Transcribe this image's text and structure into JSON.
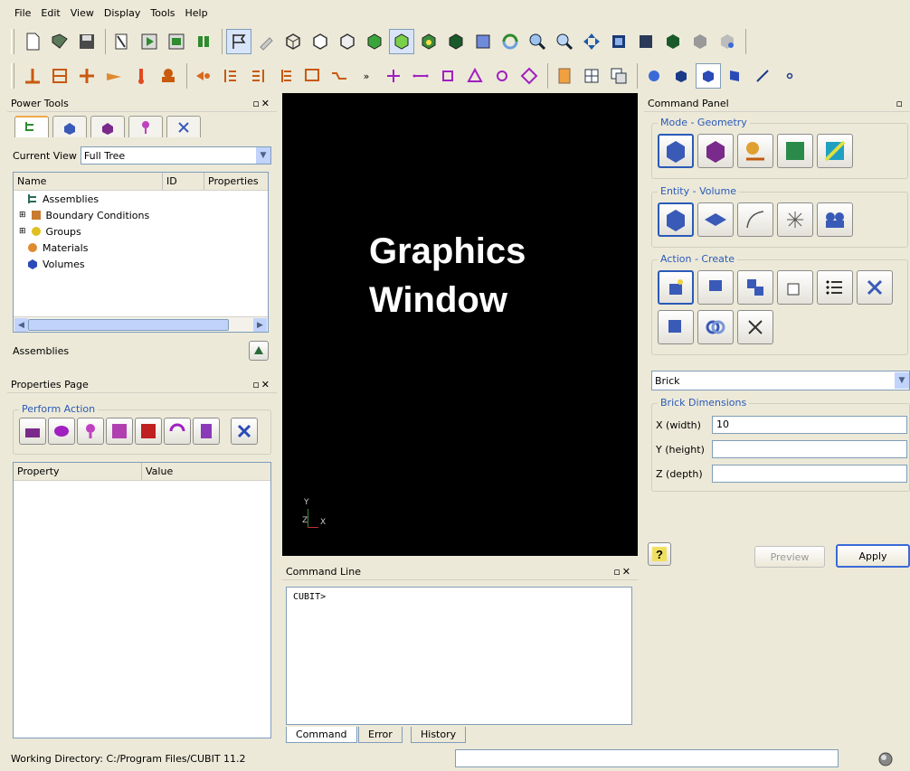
{
  "menu": [
    "File",
    "Edit",
    "View",
    "Display",
    "Tools",
    "Help"
  ],
  "power_tools": {
    "title": "Power Tools",
    "current_view_label": "Current View",
    "current_view_value": "Full Tree",
    "columns": [
      "Name",
      "ID",
      "Properties"
    ],
    "tree_items": [
      "Assemblies",
      "Boundary Conditions",
      "Groups",
      "Materials",
      "Volumes"
    ],
    "footer_label": "Assemblies"
  },
  "properties_page": {
    "title": "Properties Page",
    "perform_action": "Perform Action",
    "columns": [
      "Property",
      "Value"
    ]
  },
  "graphics": {
    "line1": "Graphics",
    "line2": "Window",
    "axis_y": "Y",
    "axis_z": "Z",
    "axis_x": "X"
  },
  "command_line": {
    "title": "Command Line",
    "prompt": "CUBIT>",
    "tabs": [
      "Command",
      "Error",
      "History"
    ]
  },
  "command_panel": {
    "title": "Command Panel",
    "mode_label": "Mode - Geometry",
    "entity_label": "Entity - Volume",
    "action_label": "Action - Create",
    "shape_value": "Brick",
    "dims_label": "Brick Dimensions",
    "x_label": "X (width)",
    "x_value": "10",
    "y_label": "Y (height)",
    "y_value": "",
    "z_label": "Z (depth)",
    "z_value": "",
    "preview": "Preview",
    "apply": "Apply"
  },
  "status": {
    "working_dir": "Working Directory: C:/Program Files/CUBIT 11.2"
  },
  "colors": {
    "accent": "#2a5ab8",
    "graphics_bg": "#000000",
    "toolbar_green": "#2e8b2e",
    "toolbar_purple": "#a020c0"
  }
}
